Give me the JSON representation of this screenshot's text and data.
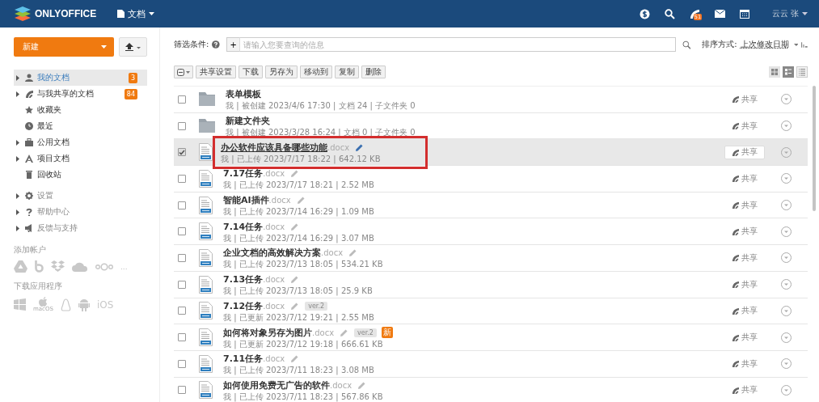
{
  "header": {
    "logo": "ONLYOFFICE",
    "module": "文档",
    "notification_count": "51",
    "user": "云云 张"
  },
  "sidebar": {
    "create_button": "新建",
    "items": [
      {
        "label": "我的文档",
        "expandable": true,
        "selected": true,
        "badge": "3"
      },
      {
        "label": "与我共享的文档",
        "expandable": true,
        "selected": false,
        "badge": "84"
      },
      {
        "label": "收藏夹",
        "expandable": false,
        "selected": false
      },
      {
        "label": "最近",
        "expandable": false,
        "selected": false
      },
      {
        "label": "公用文档",
        "expandable": true,
        "selected": false
      },
      {
        "label": "项目文档",
        "expandable": true,
        "selected": false
      },
      {
        "label": "回收站",
        "expandable": false,
        "selected": false
      }
    ],
    "settings": [
      "设置",
      "帮助中心",
      "反馈与支持"
    ],
    "accounts_title": "添加帐户",
    "accounts_more": "...",
    "apps_title": "下载应用程序",
    "apps_ios": "iOS",
    "apps_macos": "macOS"
  },
  "filter": {
    "label": "筛选条件:",
    "add": "+",
    "placeholder": "请输入您要查询的信息",
    "sort_label": "排序方式:",
    "sort_value": "上次修改日期"
  },
  "toolbar": [
    "共享设置",
    "下载",
    "另存为",
    "移动到",
    "复制",
    "删除"
  ],
  "rows": [
    {
      "kind": "folder",
      "name": "表单模板",
      "ext": "",
      "meta": "我 | 被创建 2023/4/6 17:30 | 文档 24 | 子文件夹 0",
      "selected": false,
      "highlighted": false,
      "share": "共享"
    },
    {
      "kind": "folder",
      "name": "新建文件夹",
      "ext": "",
      "meta": "我 | 被创建 2023/3/28 16:24 | 文档 0 | 子文件夹 0",
      "selected": false,
      "highlighted": false,
      "share": "共享"
    },
    {
      "kind": "file",
      "name": "办公软件应该具备哪些功能",
      "ext": ".docx",
      "meta": "我 | 已上传 2023/7/17 18:22 | 642.12 KB",
      "selected": true,
      "highlighted": true,
      "share": "共享"
    },
    {
      "kind": "file",
      "name": "7.17任务",
      "ext": ".docx",
      "meta": "我 | 已上传 2023/7/17 18:21 | 2.52 MB",
      "selected": false,
      "highlighted": false,
      "share": "共享"
    },
    {
      "kind": "file",
      "name": "智能AI插件",
      "ext": ".docx",
      "meta": "我 | 已上传 2023/7/14 16:29 | 1.09 MB",
      "selected": false,
      "highlighted": false,
      "share": "共享"
    },
    {
      "kind": "file",
      "name": "7.14任务",
      "ext": ".docx",
      "meta": "我 | 已上传 2023/7/14 16:29 | 3.07 MB",
      "selected": false,
      "highlighted": false,
      "share": "共享"
    },
    {
      "kind": "file",
      "name": "企业文档的高效解决方案",
      "ext": ".docx",
      "meta": "我 | 已上传 2023/7/13 18:05 | 534.21 KB",
      "selected": false,
      "highlighted": false,
      "share": "共享"
    },
    {
      "kind": "file",
      "name": "7.13任务",
      "ext": ".docx",
      "meta": "我 | 已上传 2023/7/13 18:05 | 25.9 KB",
      "selected": false,
      "highlighted": false,
      "share": "共享"
    },
    {
      "kind": "file",
      "name": "7.12任务",
      "ext": ".docx",
      "meta": "我 | 已更新 2023/7/12 19:21 | 2.55 MB",
      "selected": false,
      "highlighted": false,
      "share": "共享",
      "version": "ver.2"
    },
    {
      "kind": "file",
      "name": "如何将对象另存为图片",
      "ext": ".docx",
      "meta": "我 | 已更新 2023/7/12 19:18 | 666.61 KB",
      "selected": false,
      "highlighted": false,
      "share": "共享",
      "version": "ver.2",
      "new_badge": "新"
    },
    {
      "kind": "file",
      "name": "7.11任务",
      "ext": ".docx",
      "meta": "我 | 已上传 2023/7/11 18:23 | 3.08 MB",
      "selected": false,
      "highlighted": false,
      "share": "共享"
    },
    {
      "kind": "file",
      "name": "如何使用免费无广告的软件",
      "ext": ".docx",
      "meta": "我 | 已上传 2023/7/11 18:23 | 567.86 KB",
      "selected": false,
      "highlighted": false,
      "share": "共享"
    }
  ]
}
